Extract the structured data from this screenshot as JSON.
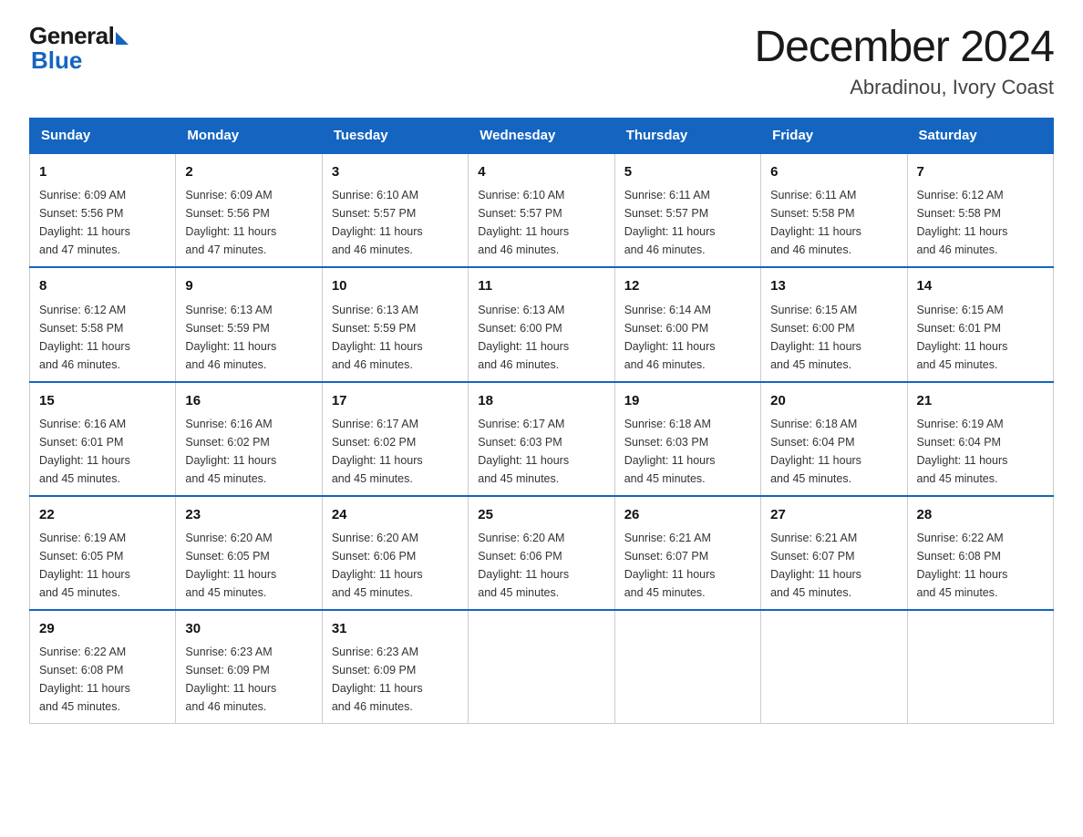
{
  "header": {
    "logo_general": "General",
    "logo_blue": "Blue",
    "month_title": "December 2024",
    "location": "Abradinou, Ivory Coast"
  },
  "days_of_week": [
    "Sunday",
    "Monday",
    "Tuesday",
    "Wednesday",
    "Thursday",
    "Friday",
    "Saturday"
  ],
  "weeks": [
    [
      {
        "day": "1",
        "sunrise": "6:09 AM",
        "sunset": "5:56 PM",
        "daylight": "11 hours and 47 minutes."
      },
      {
        "day": "2",
        "sunrise": "6:09 AM",
        "sunset": "5:56 PM",
        "daylight": "11 hours and 47 minutes."
      },
      {
        "day": "3",
        "sunrise": "6:10 AM",
        "sunset": "5:57 PM",
        "daylight": "11 hours and 46 minutes."
      },
      {
        "day": "4",
        "sunrise": "6:10 AM",
        "sunset": "5:57 PM",
        "daylight": "11 hours and 46 minutes."
      },
      {
        "day": "5",
        "sunrise": "6:11 AM",
        "sunset": "5:57 PM",
        "daylight": "11 hours and 46 minutes."
      },
      {
        "day": "6",
        "sunrise": "6:11 AM",
        "sunset": "5:58 PM",
        "daylight": "11 hours and 46 minutes."
      },
      {
        "day": "7",
        "sunrise": "6:12 AM",
        "sunset": "5:58 PM",
        "daylight": "11 hours and 46 minutes."
      }
    ],
    [
      {
        "day": "8",
        "sunrise": "6:12 AM",
        "sunset": "5:58 PM",
        "daylight": "11 hours and 46 minutes."
      },
      {
        "day": "9",
        "sunrise": "6:13 AM",
        "sunset": "5:59 PM",
        "daylight": "11 hours and 46 minutes."
      },
      {
        "day": "10",
        "sunrise": "6:13 AM",
        "sunset": "5:59 PM",
        "daylight": "11 hours and 46 minutes."
      },
      {
        "day": "11",
        "sunrise": "6:13 AM",
        "sunset": "6:00 PM",
        "daylight": "11 hours and 46 minutes."
      },
      {
        "day": "12",
        "sunrise": "6:14 AM",
        "sunset": "6:00 PM",
        "daylight": "11 hours and 46 minutes."
      },
      {
        "day": "13",
        "sunrise": "6:15 AM",
        "sunset": "6:00 PM",
        "daylight": "11 hours and 45 minutes."
      },
      {
        "day": "14",
        "sunrise": "6:15 AM",
        "sunset": "6:01 PM",
        "daylight": "11 hours and 45 minutes."
      }
    ],
    [
      {
        "day": "15",
        "sunrise": "6:16 AM",
        "sunset": "6:01 PM",
        "daylight": "11 hours and 45 minutes."
      },
      {
        "day": "16",
        "sunrise": "6:16 AM",
        "sunset": "6:02 PM",
        "daylight": "11 hours and 45 minutes."
      },
      {
        "day": "17",
        "sunrise": "6:17 AM",
        "sunset": "6:02 PM",
        "daylight": "11 hours and 45 minutes."
      },
      {
        "day": "18",
        "sunrise": "6:17 AM",
        "sunset": "6:03 PM",
        "daylight": "11 hours and 45 minutes."
      },
      {
        "day": "19",
        "sunrise": "6:18 AM",
        "sunset": "6:03 PM",
        "daylight": "11 hours and 45 minutes."
      },
      {
        "day": "20",
        "sunrise": "6:18 AM",
        "sunset": "6:04 PM",
        "daylight": "11 hours and 45 minutes."
      },
      {
        "day": "21",
        "sunrise": "6:19 AM",
        "sunset": "6:04 PM",
        "daylight": "11 hours and 45 minutes."
      }
    ],
    [
      {
        "day": "22",
        "sunrise": "6:19 AM",
        "sunset": "6:05 PM",
        "daylight": "11 hours and 45 minutes."
      },
      {
        "day": "23",
        "sunrise": "6:20 AM",
        "sunset": "6:05 PM",
        "daylight": "11 hours and 45 minutes."
      },
      {
        "day": "24",
        "sunrise": "6:20 AM",
        "sunset": "6:06 PM",
        "daylight": "11 hours and 45 minutes."
      },
      {
        "day": "25",
        "sunrise": "6:20 AM",
        "sunset": "6:06 PM",
        "daylight": "11 hours and 45 minutes."
      },
      {
        "day": "26",
        "sunrise": "6:21 AM",
        "sunset": "6:07 PM",
        "daylight": "11 hours and 45 minutes."
      },
      {
        "day": "27",
        "sunrise": "6:21 AM",
        "sunset": "6:07 PM",
        "daylight": "11 hours and 45 minutes."
      },
      {
        "day": "28",
        "sunrise": "6:22 AM",
        "sunset": "6:08 PM",
        "daylight": "11 hours and 45 minutes."
      }
    ],
    [
      {
        "day": "29",
        "sunrise": "6:22 AM",
        "sunset": "6:08 PM",
        "daylight": "11 hours and 45 minutes."
      },
      {
        "day": "30",
        "sunrise": "6:23 AM",
        "sunset": "6:09 PM",
        "daylight": "11 hours and 46 minutes."
      },
      {
        "day": "31",
        "sunrise": "6:23 AM",
        "sunset": "6:09 PM",
        "daylight": "11 hours and 46 minutes."
      },
      null,
      null,
      null,
      null
    ]
  ],
  "labels": {
    "sunrise": "Sunrise:",
    "sunset": "Sunset:",
    "daylight": "Daylight:"
  }
}
